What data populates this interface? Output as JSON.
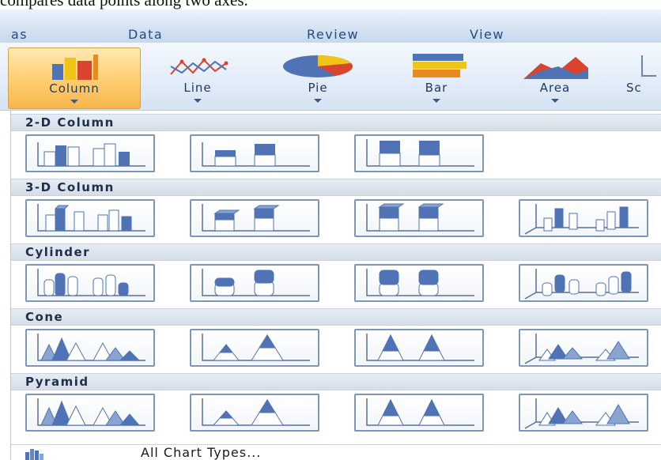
{
  "document": {
    "visible_text": "compares data points along two axes."
  },
  "tabs": [
    {
      "label": "as"
    },
    {
      "label": "Data"
    },
    {
      "label": "Review"
    },
    {
      "label": "View"
    }
  ],
  "ribbon": {
    "buttons": [
      {
        "label": "Column",
        "icon": "column-chart-icon",
        "selected": true
      },
      {
        "label": "Line",
        "icon": "line-chart-icon",
        "selected": false
      },
      {
        "label": "Pie",
        "icon": "pie-chart-icon",
        "selected": false
      },
      {
        "label": "Bar",
        "icon": "bar-chart-icon",
        "selected": false
      },
      {
        "label": "Area",
        "icon": "area-chart-icon",
        "selected": false
      },
      {
        "label": "Sc",
        "icon": "scatter-chart-icon",
        "selected": false
      }
    ]
  },
  "gallery": {
    "sections": [
      {
        "title": "2-D Column",
        "items": [
          "Clustered Column",
          "Stacked Column",
          "100% Stacked Column"
        ]
      },
      {
        "title": "3-D Column",
        "items": [
          "3-D Clustered Column",
          "Stacked Column in 3-D",
          "100% Stacked Column in 3-D",
          "3-D Column"
        ]
      },
      {
        "title": "Cylinder",
        "items": [
          "Clustered Cylinder",
          "Stacked Cylinder",
          "100% Stacked Cylinder",
          "3-D Cylinder"
        ]
      },
      {
        "title": "Cone",
        "items": [
          "Clustered Cone",
          "Stacked Cone",
          "100% Stacked Cone",
          "3-D Cone"
        ]
      },
      {
        "title": "Pyramid",
        "items": [
          "Clustered Pyramid",
          "Stacked Pyramid",
          "100% Stacked Pyramid",
          "3-D Pyramid"
        ]
      }
    ]
  },
  "footer": {
    "label": "All Chart Types...",
    "icon": "all-chart-types-icon"
  },
  "colors": {
    "selected_bg": "#ffd27a",
    "thumb_border": "#7d96b8",
    "bar_blue": "#4f73b4",
    "ribbon_bg": "#dbe7f5"
  }
}
